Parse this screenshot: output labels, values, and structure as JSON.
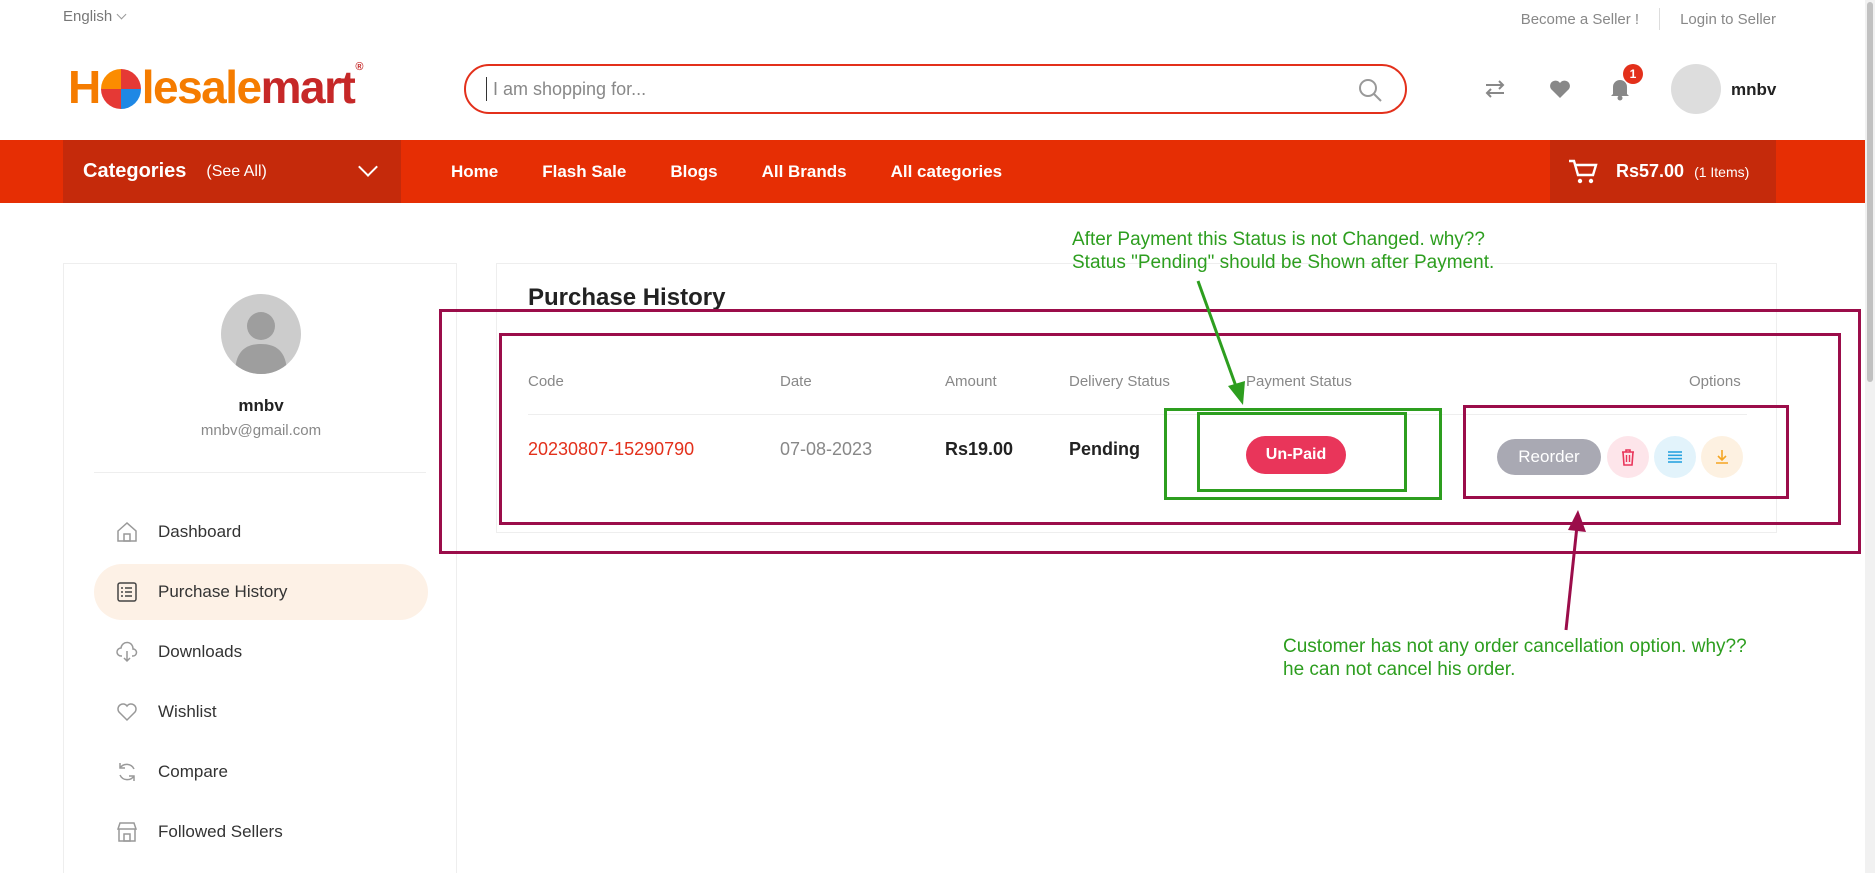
{
  "topbar": {
    "language": "English",
    "become_seller": "Become a Seller !",
    "login_seller": "Login to Seller"
  },
  "logo": {
    "part1": "H",
    "part2": "lesale",
    "part3": "mart",
    "reg": "®"
  },
  "search": {
    "placeholder": "I am shopping for..."
  },
  "header": {
    "notification_count": "1",
    "username": "mnbv"
  },
  "nav": {
    "categories": "Categories",
    "see_all": "(See All)",
    "links": [
      "Home",
      "Flash Sale",
      "Blogs",
      "All Brands",
      "All categories"
    ],
    "cart_amount": "Rs57.00",
    "cart_items": "(1 Items)"
  },
  "sidebar": {
    "name": "mnbv",
    "email": "mnbv@gmail.com",
    "items": [
      "Dashboard",
      "Purchase History",
      "Downloads",
      "Wishlist",
      "Compare",
      "Followed Sellers"
    ]
  },
  "main": {
    "title": "Purchase History",
    "columns": [
      "Code",
      "Date",
      "Amount",
      "Delivery Status",
      "Payment Status",
      "Options"
    ],
    "row": {
      "code": "20230807-15290790",
      "date": "07-08-2023",
      "amount": "Rs19.00",
      "delivery": "Pending",
      "payment": "Un-Paid",
      "reorder": "Reorder"
    }
  },
  "annotations": {
    "note1_line1": "After Payment this Status is not Changed. why??",
    "note1_line2": "Status \"Pending\" should be Shown after Payment.",
    "note2_line1": "Customer has not any order cancellation option.  why??",
    "note2_line2": "he can not cancel his order.",
    "green": "#2d9e1f",
    "maroon": "#9b0d4a"
  },
  "colors": {
    "brand": "#e62e04",
    "brand_dark": "#c52a0b",
    "unpaid": "#e9355a"
  }
}
